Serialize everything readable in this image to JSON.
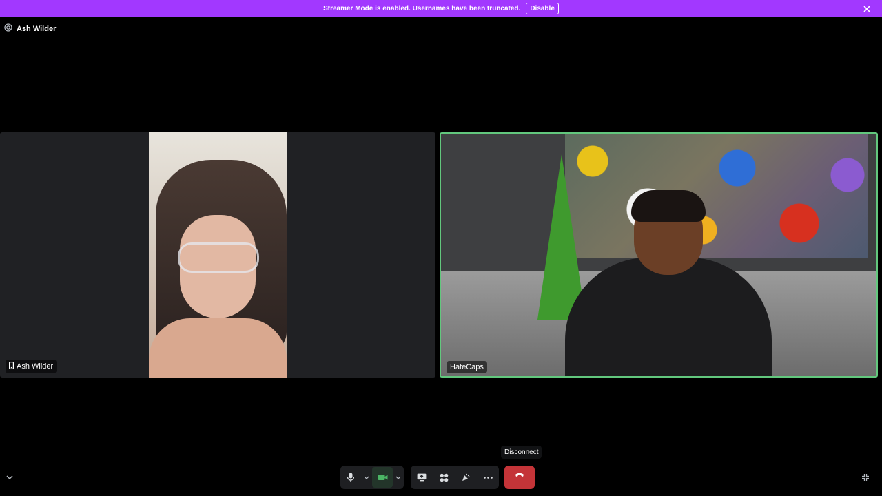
{
  "banner": {
    "message": "Streamer Mode is enabled. Usernames have been truncated.",
    "disable_label": "Disable",
    "color": "#a238ff"
  },
  "channel": {
    "icon": "at-icon",
    "name": "Ash Wilder"
  },
  "tiles": [
    {
      "name": "Ash Wilder",
      "device_icon": "mobile-phone-icon",
      "speaking": false
    },
    {
      "name": "HateCaps",
      "speaking": true,
      "speaking_color": "#62c77d"
    }
  ],
  "controls": {
    "buttons": [
      "microphone-icon",
      "camera-icon",
      "screen-share-icon",
      "activities-icon",
      "soundboard-icon",
      "more-icon"
    ],
    "disconnect_tooltip": "Disconnect",
    "disconnect_color": "#c43438"
  }
}
